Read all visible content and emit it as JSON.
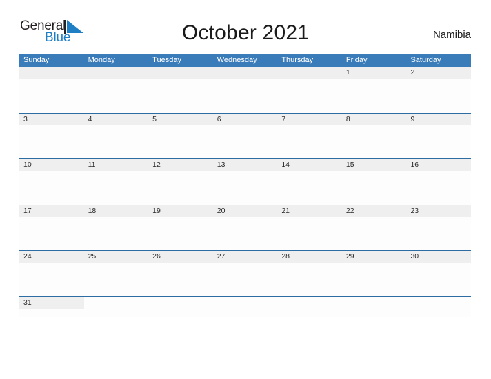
{
  "brand": {
    "word1": "General",
    "word2": "Blue",
    "flag_icon": "blue-triangle-flag-icon",
    "word1_color": "#231f20",
    "word2_color": "#1f7fc4"
  },
  "header": {
    "title": "October 2021",
    "region": "Namibia"
  },
  "theme": {
    "header_blue": "#3a7cba",
    "rule_blue": "#2e6da4",
    "band_gray": "#efefef",
    "cell_white": "#fdfdfd",
    "number_color": "#2b2b2b"
  },
  "calendar": {
    "month": "October",
    "year": "2021",
    "weekdays": [
      "Sunday",
      "Monday",
      "Tuesday",
      "Wednesday",
      "Thursday",
      "Friday",
      "Saturday"
    ],
    "weeks": [
      [
        "",
        "",
        "",
        "",
        "",
        "1",
        "2"
      ],
      [
        "3",
        "4",
        "5",
        "6",
        "7",
        "8",
        "9"
      ],
      [
        "10",
        "11",
        "12",
        "13",
        "14",
        "15",
        "16"
      ],
      [
        "17",
        "18",
        "19",
        "20",
        "21",
        "22",
        "23"
      ],
      [
        "24",
        "25",
        "26",
        "27",
        "28",
        "29",
        "30"
      ],
      [
        "31",
        "",
        "",
        "",
        "",
        "",
        ""
      ]
    ]
  }
}
